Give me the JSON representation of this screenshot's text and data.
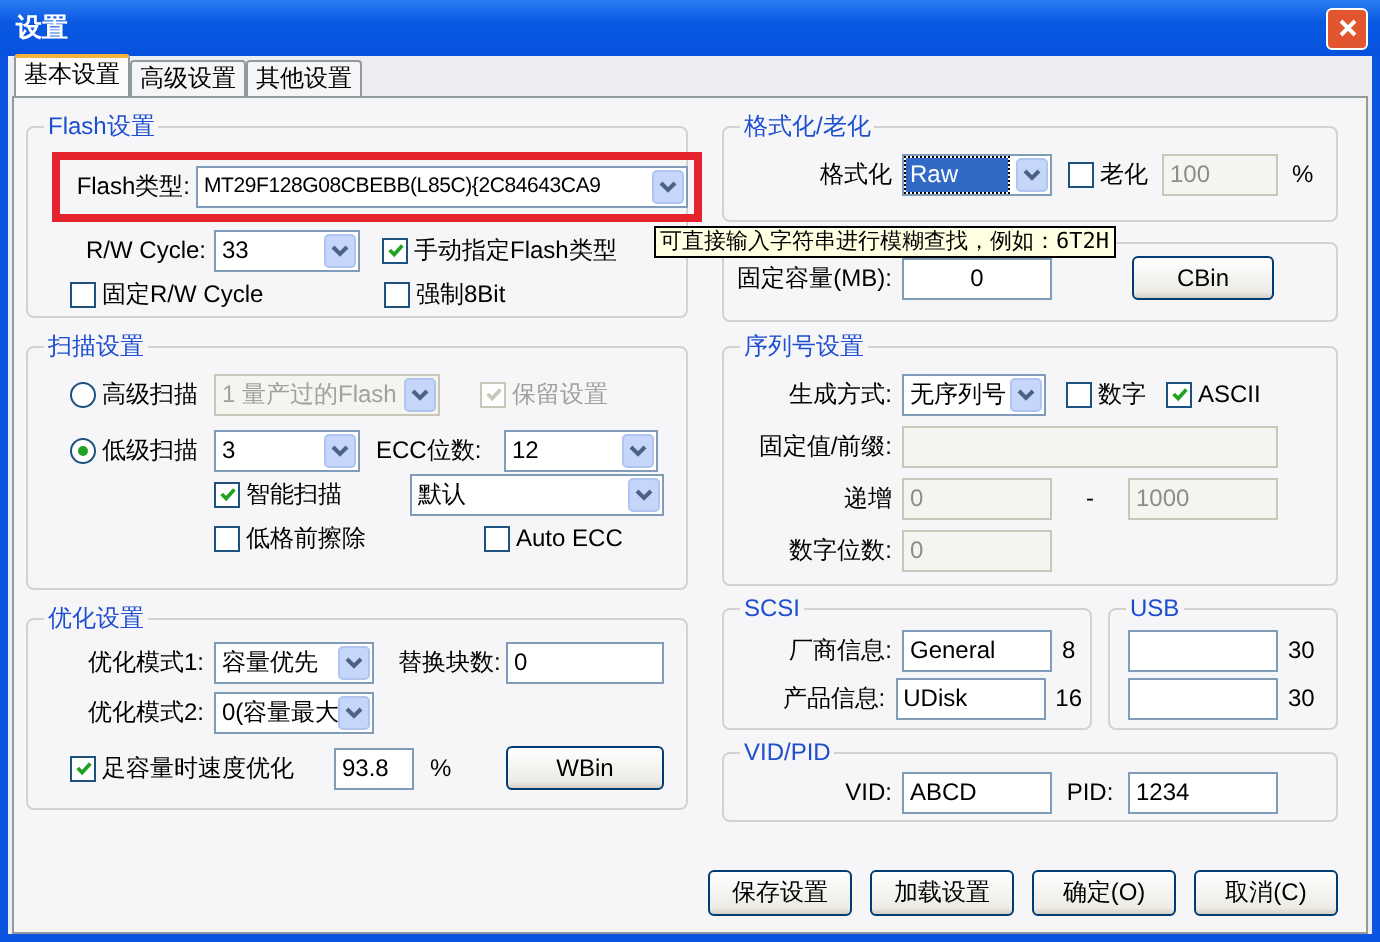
{
  "window": {
    "title": "设置"
  },
  "tabs": [
    {
      "label": "基本设置",
      "selected": true
    },
    {
      "label": "高级设置",
      "selected": false
    },
    {
      "label": "其他设置",
      "selected": false
    }
  ],
  "left_groups": [
    {
      "title": "Flash设置",
      "rows": [
        {
          "highlighted": true,
          "items": [
            {
              "kind": "label",
              "text": "Flash类型:"
            },
            {
              "kind": "combo",
              "value": "MT29F128G08CBEBB(L85C){2C84643CA9",
              "disabled": false
            }
          ]
        },
        {
          "items": [
            {
              "kind": "label",
              "text": "R/W Cycle:"
            },
            {
              "kind": "combo",
              "value": "33",
              "disabled": false
            },
            {
              "kind": "checkbox",
              "label": "手动指定Flash类型",
              "checked": true,
              "disabled": false
            }
          ]
        },
        {
          "items": [
            {
              "kind": "checkbox",
              "label": "固定R/W Cycle",
              "checked": false,
              "disabled": false
            },
            {
              "kind": "checkbox",
              "label": "强制8Bit",
              "checked": false,
              "disabled": false
            }
          ]
        }
      ]
    },
    {
      "title": "扫描设置",
      "rows": [
        {
          "items": [
            {
              "kind": "radio",
              "label": "高级扫描",
              "selected": false
            },
            {
              "kind": "combo",
              "value": "1 量产过的Flash",
              "disabled": true
            },
            {
              "kind": "checkbox",
              "label": "保留设置",
              "checked": true,
              "disabled": true
            }
          ]
        },
        {
          "items": [
            {
              "kind": "radio",
              "label": "低级扫描",
              "selected": true
            },
            {
              "kind": "combo",
              "value": "3",
              "disabled": false
            },
            {
              "kind": "label",
              "text": "ECC位数:"
            },
            {
              "kind": "combo",
              "value": "12",
              "disabled": false
            }
          ]
        },
        {
          "items": [
            {
              "kind": "checkbox",
              "label": "智能扫描",
              "checked": true,
              "disabled": false
            },
            {
              "kind": "combo",
              "value": "默认",
              "disabled": false
            }
          ]
        },
        {
          "items": [
            {
              "kind": "checkbox",
              "label": "低格前擦除",
              "checked": false,
              "disabled": false
            },
            {
              "kind": "checkbox",
              "label": "Auto ECC",
              "checked": false,
              "disabled": false
            }
          ]
        }
      ]
    },
    {
      "title": "优化设置",
      "rows": [
        {
          "items": [
            {
              "kind": "label",
              "text": "优化模式1:"
            },
            {
              "kind": "combo",
              "value": "容量优先",
              "disabled": false
            },
            {
              "kind": "label",
              "text": "替换块数:"
            },
            {
              "kind": "field",
              "value": "0",
              "disabled": false
            }
          ]
        },
        {
          "items": [
            {
              "kind": "label",
              "text": "优化模式2:"
            },
            {
              "kind": "combo",
              "value": "0(容量最大",
              "disabled": false
            }
          ]
        },
        {
          "items": [
            {
              "kind": "checkbox",
              "label": "足容量时速度优化",
              "checked": true,
              "disabled": false
            },
            {
              "kind": "field",
              "value": "93.8",
              "disabled": false
            },
            {
              "kind": "label",
              "text": "%"
            },
            {
              "kind": "button",
              "label": "WBin"
            }
          ]
        }
      ]
    }
  ],
  "right_groups": [
    {
      "title": "格式化/老化",
      "rows": [
        {
          "items": [
            {
              "kind": "label",
              "text": "格式化"
            },
            {
              "kind": "combo",
              "value": "Raw",
              "disabled": false,
              "focused": true
            },
            {
              "kind": "checkbox",
              "label": "老化",
              "checked": false,
              "disabled": false
            },
            {
              "kind": "field",
              "value": "100",
              "disabled": true
            },
            {
              "kind": "label",
              "text": "%"
            }
          ]
        }
      ]
    },
    {
      "rows": [
        {
          "items": [
            {
              "kind": "label",
              "text": "固定容量(MB):"
            },
            {
              "kind": "field",
              "value": "0",
              "disabled": false
            },
            {
              "kind": "button",
              "label": "CBin"
            }
          ]
        }
      ]
    },
    {
      "title": "序列号设置",
      "rows": [
        {
          "items": [
            {
              "kind": "label",
              "text": "生成方式:"
            },
            {
              "kind": "combo",
              "value": "无序列号",
              "disabled": false
            },
            {
              "kind": "checkbox",
              "label": "数字",
              "checked": false,
              "disabled": false
            },
            {
              "kind": "checkbox",
              "label": "ASCII",
              "checked": true,
              "disabled": false
            }
          ]
        },
        {
          "items": [
            {
              "kind": "label",
              "text": "固定值/前缀:"
            },
            {
              "kind": "field",
              "disabled": true
            }
          ]
        },
        {
          "items": [
            {
              "kind": "label",
              "text": "递增"
            },
            {
              "kind": "field",
              "value": "0",
              "disabled": true
            },
            {
              "kind": "label",
              "text": "-"
            },
            {
              "kind": "field",
              "value": "1000",
              "disabled": true
            }
          ]
        },
        {
          "items": [
            {
              "kind": "label",
              "text": "数字位数:"
            },
            {
              "kind": "field",
              "value": "0",
              "disabled": true
            }
          ]
        }
      ]
    },
    {
      "title": "SCSI",
      "rows": [
        {
          "items": [
            {
              "kind": "label",
              "text": "厂商信息:"
            },
            {
              "kind": "field",
              "value": "General",
              "disabled": false
            },
            {
              "kind": "label",
              "text": "8"
            }
          ]
        },
        {
          "items": [
            {
              "kind": "label",
              "text": "产品信息:"
            },
            {
              "kind": "field",
              "value": "UDisk",
              "disabled": false
            },
            {
              "kind": "label",
              "text": "16"
            }
          ]
        }
      ]
    },
    {
      "title": "USB",
      "rows": [
        {
          "items": [
            {
              "kind": "field",
              "disabled": false
            },
            {
              "kind": "label",
              "text": "30"
            }
          ]
        },
        {
          "items": [
            {
              "kind": "field",
              "disabled": false
            },
            {
              "kind": "label",
              "text": "30"
            }
          ]
        }
      ]
    },
    {
      "title": "VID/PID",
      "rows": [
        {
          "items": [
            {
              "kind": "label",
              "text": "VID:"
            },
            {
              "kind": "field",
              "value": "ABCD",
              "disabled": false
            },
            {
              "kind": "label",
              "text": "PID:"
            },
            {
              "kind": "field",
              "value": "1234",
              "disabled": false
            }
          ]
        }
      ]
    }
  ],
  "tooltip": {
    "text": "可直接输入字符串进行模糊查找，例如：6T2H"
  },
  "buttons": [
    {
      "label": "保存设置"
    },
    {
      "label": "加载设置"
    },
    {
      "label": "确定(O)"
    },
    {
      "label": "取消(C)"
    }
  ]
}
